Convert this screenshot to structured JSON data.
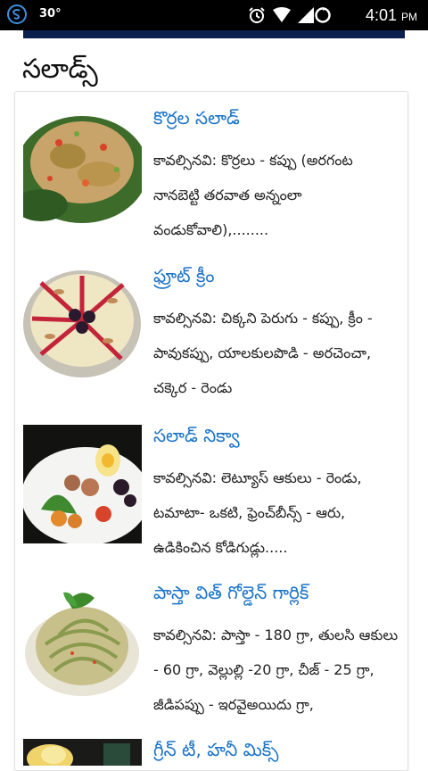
{
  "status_bar": {
    "temperature": "30°",
    "time": "4:01",
    "ampm": "PM"
  },
  "section_title": "సలాడ్స్",
  "items": [
    {
      "title": "కొర్రల సలాడ్",
      "description": "కావల్సినవి: కొర్రలు - కప్పు (అరగంట నానబెట్టి తరవాత అన్నంలా వండుకోవాలి),........"
    },
    {
      "title": "ఫ్రూట్ క్రీం",
      "description": "కావల్సినవి: చిక్కని పెరుగు - కప్పు, క్రీం - పావుకప్పు, యాలకులపొడి - అరచెంచా, చక్కెర - రెండు"
    },
    {
      "title": "సలాడ్ నిక్వా",
      "description": "కావల్సినవి: లెట్యూస్ ఆకులు - రెండు, టమాటా- ఒకటి, ఫ్రెంచ్‌బీన్స్ - ఆరు, ఉడికించిన కోడిగుడ్లు....."
    },
    {
      "title": "పాస్తా విత్ గోల్డెన్ గార్లిక్",
      "description": "కావల్సినవి: పాస్తా - 180 గ్రా, తులసి ఆకులు - 60 గ్రా, వెల్లుల్లి -20 గ్రా, చీజ్ - 25 గ్రా, జీడిపప్పు - ఇరవైఅయిదు గ్రా,"
    },
    {
      "title": "గ్రీన్ టీ, హనీ మిక్స్",
      "description": ""
    }
  ],
  "colors": {
    "link": "#1a73c8",
    "topbar": "#0b1f4d"
  }
}
